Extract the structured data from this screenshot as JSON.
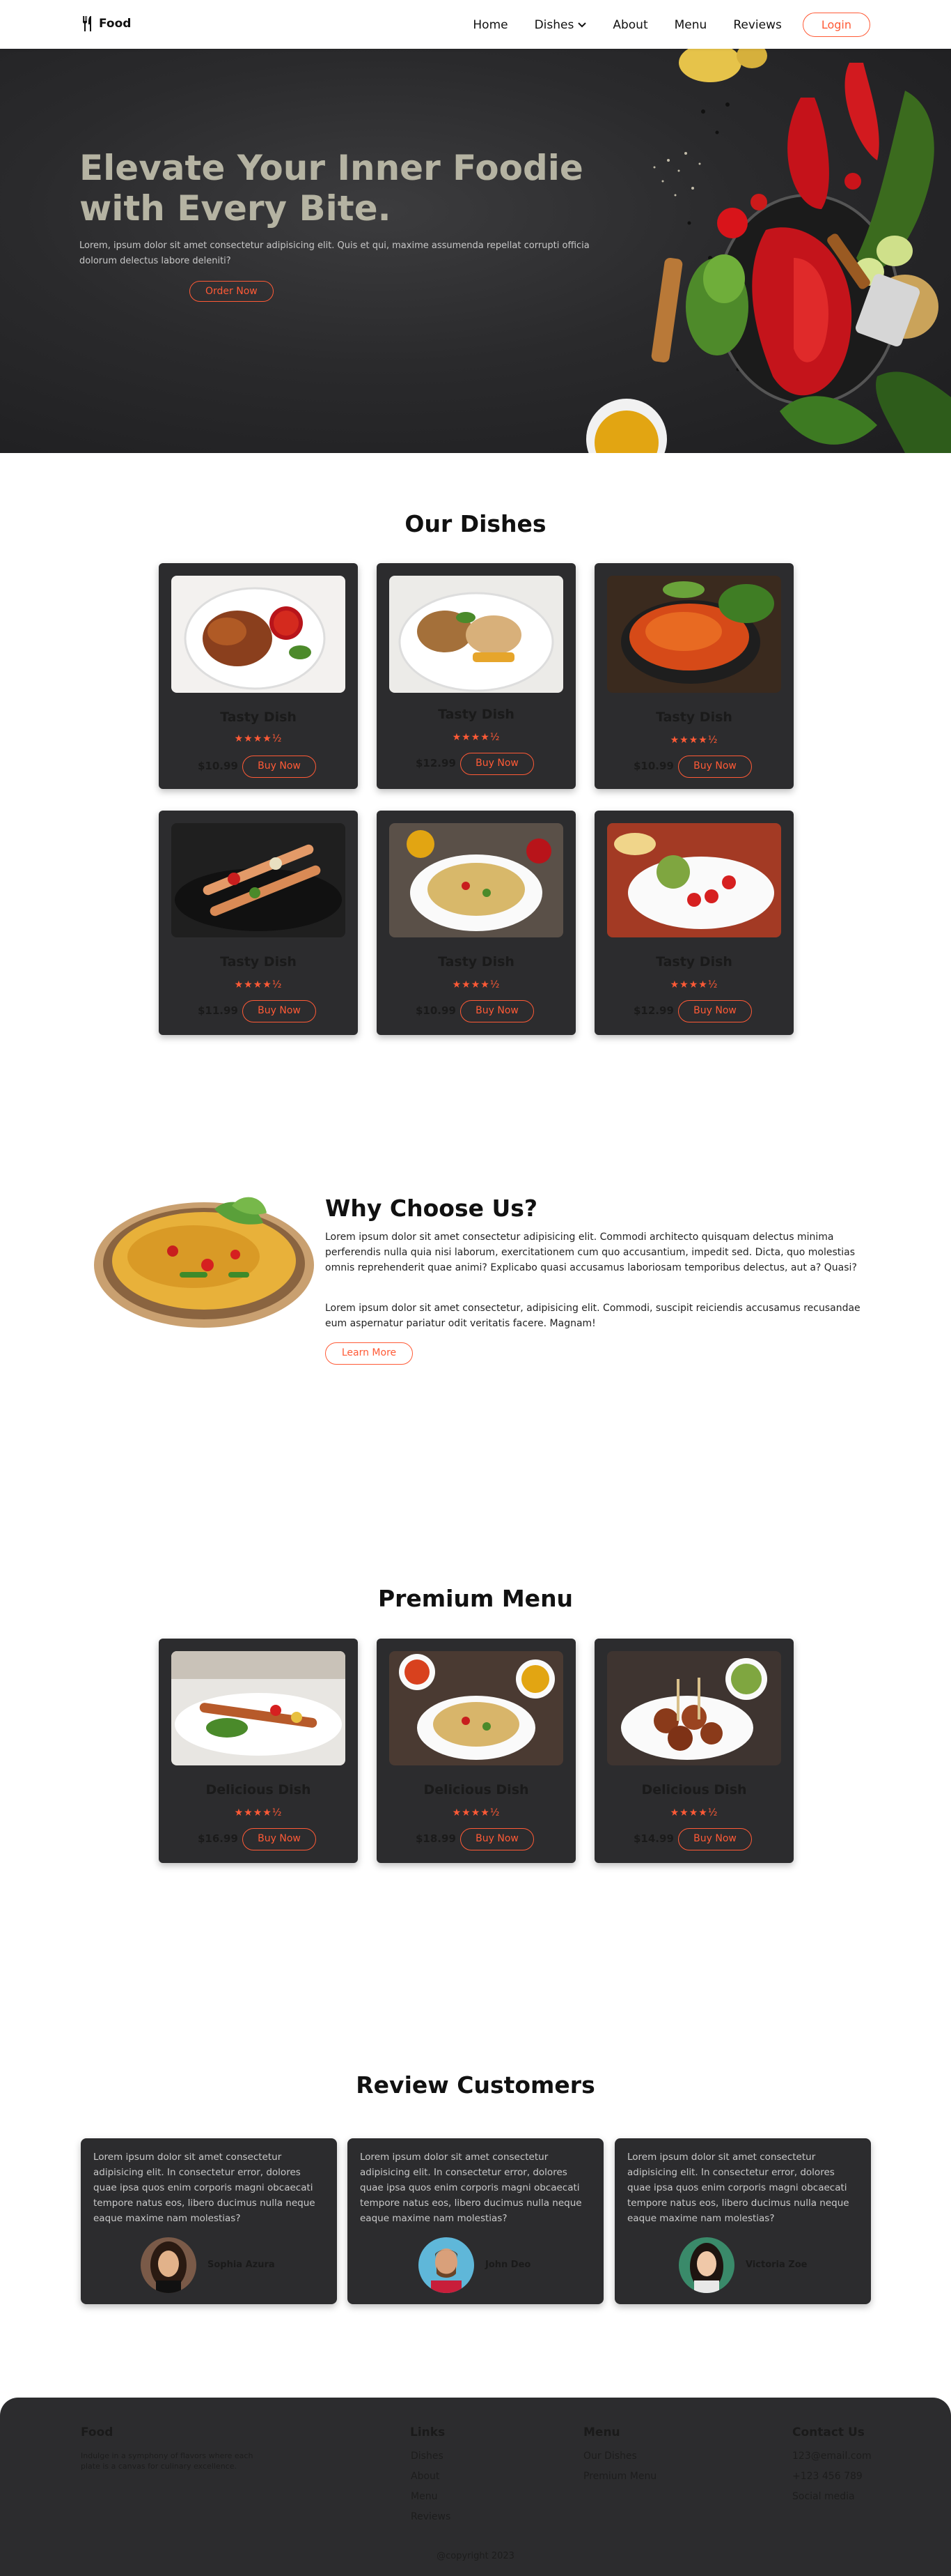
{
  "nav": {
    "brand": "Food",
    "links": [
      "Home",
      "Dishes",
      "About",
      "Menu",
      "Reviews"
    ],
    "login": "Login"
  },
  "hero": {
    "title": "Elevate Your Inner Foodie with Every Bite.",
    "subtitle": "Lorem, ipsum dolor sit amet consectetur adipisicing elit. Quis et qui, maxime assumenda repellat corrupti officia dolorum delectus labore deleniti?",
    "button": "Order Now"
  },
  "dishes": {
    "title": "Our Dishes",
    "items": [
      {
        "name": "Tasty Dish",
        "price": "$10.99",
        "button": "Buy Now",
        "rating": 4.5
      },
      {
        "name": "Tasty Dish",
        "price": "$12.99",
        "button": "Buy Now",
        "rating": 4.5
      },
      {
        "name": "Tasty Dish",
        "price": "$10.99",
        "button": "Buy Now",
        "rating": 4.5
      },
      {
        "name": "Tasty Dish",
        "price": "$11.99",
        "button": "Buy Now",
        "rating": 4.5
      },
      {
        "name": "Tasty Dish",
        "price": "$10.99",
        "button": "Buy Now",
        "rating": 4.5
      },
      {
        "name": "Tasty Dish",
        "price": "$12.99",
        "button": "Buy Now",
        "rating": 4.5
      }
    ]
  },
  "why": {
    "title": "Why Choose Us?",
    "p1": "Lorem ipsum dolor sit amet consectetur adipisicing elit. Commodi architecto quisquam delectus minima perferendis nulla quia nisi laborum, exercitationem cum quo accusantium, impedit sed. Dicta, quo molestias omnis reprehenderit quae animi? Explicabo quasi accusamus laboriosam temporibus delectus, aut a? Quasi?",
    "p2": "Lorem ipsum dolor sit amet consectetur, adipisicing elit. Commodi, suscipit reiciendis accusamus recusandae eum aspernatur pariatur odit veritatis facere. Magnam!",
    "button": "Learn More"
  },
  "premium": {
    "title": "Premium Menu",
    "items": [
      {
        "name": "Delicious Dish",
        "price": "$16.99",
        "button": "Buy Now",
        "rating": 4.5
      },
      {
        "name": "Delicious Dish",
        "price": "$18.99",
        "button": "Buy Now",
        "rating": 4.5
      },
      {
        "name": "Delicious Dish",
        "price": "$14.99",
        "button": "Buy Now",
        "rating": 4.5
      }
    ]
  },
  "reviews": {
    "title": "Review Customers",
    "text": "Lorem ipsum dolor sit amet consectetur adipisicing elit. In consectetur error, dolores quae ipsa quos enim corporis magni obcaecati tempore natus eos, libero ducimus nulla neque eaque maxime nam molestias?",
    "items": [
      {
        "name": "Sophia Azura"
      },
      {
        "name": "John Deo"
      },
      {
        "name": "Victoria Zoe"
      }
    ]
  },
  "footer": {
    "brand": "Food",
    "about": "Indulge in a symphony of flavors where each plate is a canvas for culinary excellence.",
    "links_title": "Links",
    "links": [
      "Dishes",
      "About",
      "Menu",
      "Reviews"
    ],
    "menu_title": "Menu",
    "menu": [
      "Our Dishes",
      "Premium Menu"
    ],
    "contact_title": "Contact Us",
    "contact": [
      "123@email.com",
      "+123 456 789",
      "Social media"
    ],
    "copyright": "@copyright 2023"
  },
  "colors": {
    "accent": "#ff5a36",
    "card": "#2c2c2e",
    "hero_title": "#b5b3a2"
  }
}
